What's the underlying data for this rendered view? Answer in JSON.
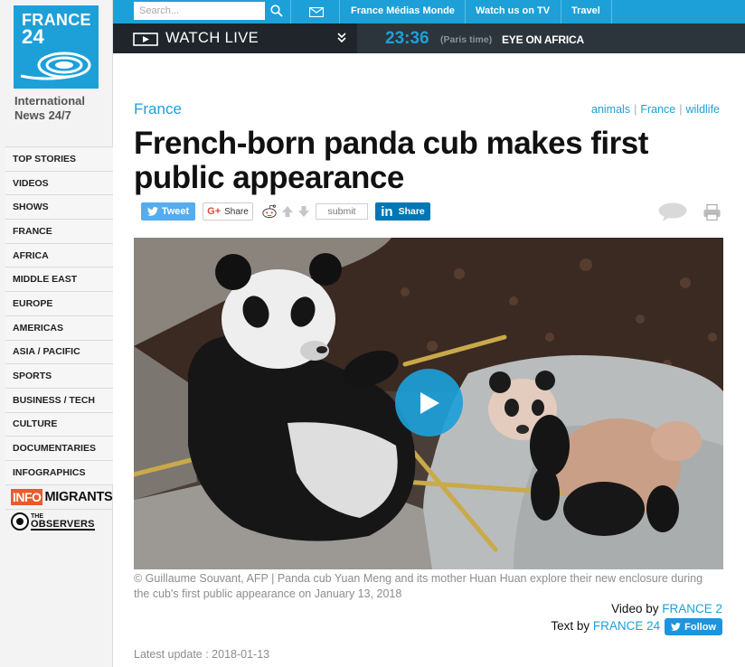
{
  "brand": {
    "logo_line1": "FRANCE",
    "logo_line2": "24",
    "tagline": "International News 24/7"
  },
  "sidebar": {
    "items": [
      {
        "label": "TOP STORIES"
      },
      {
        "label": "VIDEOS"
      },
      {
        "label": "SHOWS"
      },
      {
        "label": "FRANCE"
      },
      {
        "label": "AFRICA"
      },
      {
        "label": "MIDDLE EAST"
      },
      {
        "label": "EUROPE"
      },
      {
        "label": "AMERICAS"
      },
      {
        "label": "ASIA / PACIFIC"
      },
      {
        "label": "SPORTS"
      },
      {
        "label": "BUSINESS / TECH"
      },
      {
        "label": "CULTURE"
      },
      {
        "label": "DOCUMENTARIES"
      },
      {
        "label": "INFOGRAPHICS"
      }
    ],
    "infomigrants": {
      "part1": "INFO",
      "part2": "MIGRANTS"
    },
    "observers": {
      "the": "THE",
      "name": "OBSERVERS"
    }
  },
  "topbar": {
    "search_placeholder": "Search...",
    "links": [
      "France Médias Monde",
      "Watch us on TV",
      "Travel"
    ]
  },
  "livebar": {
    "watch_label": "WATCH LIVE",
    "time": "23:36",
    "timezone": "(Paris time)",
    "program": "EYE ON AFRICA"
  },
  "article": {
    "section": "France",
    "tags": [
      "animals",
      "France",
      "wildlife"
    ],
    "headline": "French-born panda cub makes first public appearance",
    "share": {
      "tweet": "Tweet",
      "gplus": "Share",
      "reddit_submit": "submit",
      "linkedin": "Share"
    },
    "caption": "© Guillaume Souvant, AFP | Panda cub Yuan Meng and its mother Huan Huan explore their new enclosure during the cub's first public appearance on January 13, 2018",
    "video_by_label": "Video by",
    "video_by": "FRANCE 2",
    "text_by_label": "Text by",
    "text_by": "FRANCE 24",
    "follow": "Follow",
    "latest_update": "Latest update : 2018-01-13"
  },
  "colors": {
    "accent": "#1da0d8",
    "dark_bar": "#252c33",
    "twitter": "#55acee",
    "linkedin": "#0077b5",
    "infomigrants": "#e95b2b"
  }
}
